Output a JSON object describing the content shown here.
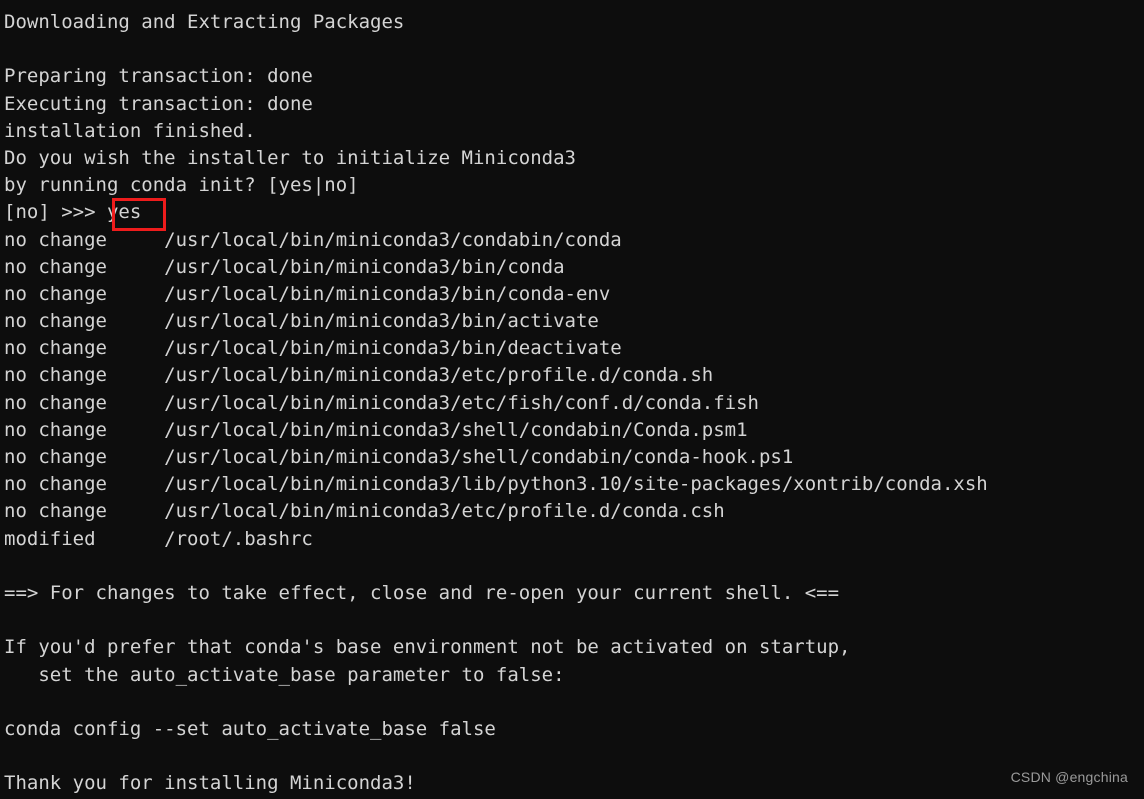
{
  "terminal": {
    "background_color": "#0d0d0d",
    "text_color": "#d4d4d4",
    "highlight_color": "#ee1c1c",
    "lines": [
      "Downloading and Extracting Packages",
      "",
      "Preparing transaction: done",
      "Executing transaction: done",
      "installation finished.",
      "Do you wish the installer to initialize Miniconda3",
      "by running conda init? [yes|no]",
      "[no] >>> yes",
      "no change     /usr/local/bin/miniconda3/condabin/conda",
      "no change     /usr/local/bin/miniconda3/bin/conda",
      "no change     /usr/local/bin/miniconda3/bin/conda-env",
      "no change     /usr/local/bin/miniconda3/bin/activate",
      "no change     /usr/local/bin/miniconda3/bin/deactivate",
      "no change     /usr/local/bin/miniconda3/etc/profile.d/conda.sh",
      "no change     /usr/local/bin/miniconda3/etc/fish/conf.d/conda.fish",
      "no change     /usr/local/bin/miniconda3/shell/condabin/Conda.psm1",
      "no change     /usr/local/bin/miniconda3/shell/condabin/conda-hook.ps1",
      "no change     /usr/local/bin/miniconda3/lib/python3.10/site-packages/xontrib/conda.xsh",
      "no change     /usr/local/bin/miniconda3/etc/profile.d/conda.csh",
      "modified      /root/.bashrc",
      "",
      "==> For changes to take effect, close and re-open your current shell. <==",
      "",
      "If you'd prefer that conda's base environment not be activated on startup,",
      "   set the auto_activate_base parameter to false:",
      "",
      "conda config --set auto_activate_base false",
      "",
      "Thank you for installing Miniconda3!"
    ],
    "prompt_answer": "yes"
  },
  "watermark": {
    "text": "CSDN @engchina"
  }
}
